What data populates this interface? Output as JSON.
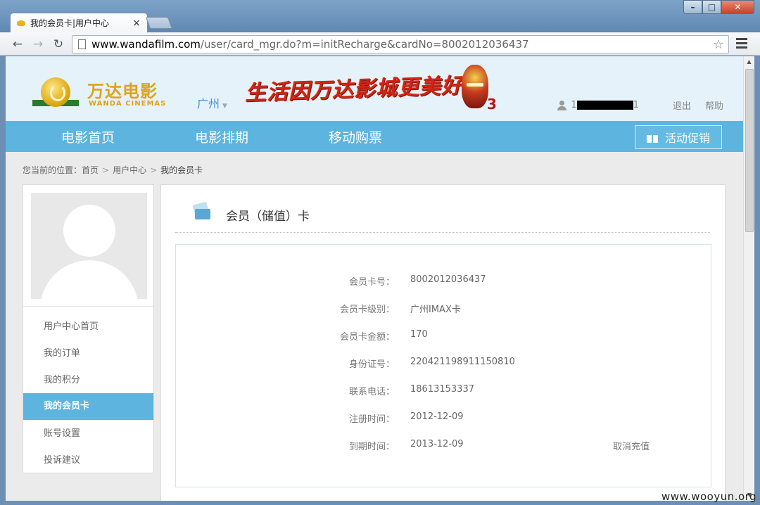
{
  "browser": {
    "tab_title": "我的会员卡|用户中心",
    "tab_close": "×",
    "url_host": "www.wandafilm.com",
    "url_path": "/user/card_mgr.do?m=initRecharge&cardNo=8002012036437",
    "back": "←",
    "forward": "→",
    "reload": "↻",
    "star": "☆",
    "window_controls": {
      "min": "–",
      "max": "□",
      "close": "✕"
    }
  },
  "header": {
    "logo_cn": "万达电影",
    "logo_en": "WANDA CINEMAS",
    "city": "广州",
    "city_arrow": "▼",
    "banner_slogan": "生活因万达影城更美好",
    "banner_number": "3",
    "user_prefix": "1",
    "user_suffix": "1",
    "logout": "退出",
    "help": "帮助"
  },
  "nav": {
    "items": [
      "电影首页",
      "电影排期",
      "移动购票"
    ],
    "promo": "活动促销"
  },
  "breadcrumb": {
    "prefix": "您当前的位置：",
    "items": [
      "首页",
      "用户中心",
      "我的会员卡"
    ],
    "sep": ">"
  },
  "sidebar": {
    "items": [
      {
        "label": "用户中心首页",
        "active": false
      },
      {
        "label": "我的订单",
        "active": false
      },
      {
        "label": "我的积分",
        "active": false
      },
      {
        "label": "我的会员卡",
        "active": true
      },
      {
        "label": "账号设置",
        "active": false
      },
      {
        "label": "投诉建议",
        "active": false
      }
    ]
  },
  "card": {
    "title": "会员（储值）卡",
    "rows": [
      {
        "label": "会员卡号：",
        "value": "8002012036437"
      },
      {
        "label": "会员卡级别：",
        "value": "广州IMAX卡"
      },
      {
        "label": "会员卡金额：",
        "value": "170"
      },
      {
        "label": "身份证号：",
        "value": "220421198911150810"
      },
      {
        "label": "联系电话：",
        "value": "18613153337"
      },
      {
        "label": "注册时间：",
        "value": "2012-12-09"
      },
      {
        "label": "到期时间：",
        "value": "2013-12-09"
      }
    ],
    "cancel_recharge": "取消充值"
  },
  "watermark": "www.wooyun.org",
  "colors": {
    "accent": "#5cb4df",
    "header_bg": "#e5f2f9",
    "logo_gold": "#e0a21a",
    "slogan_red": "#cf2418"
  }
}
